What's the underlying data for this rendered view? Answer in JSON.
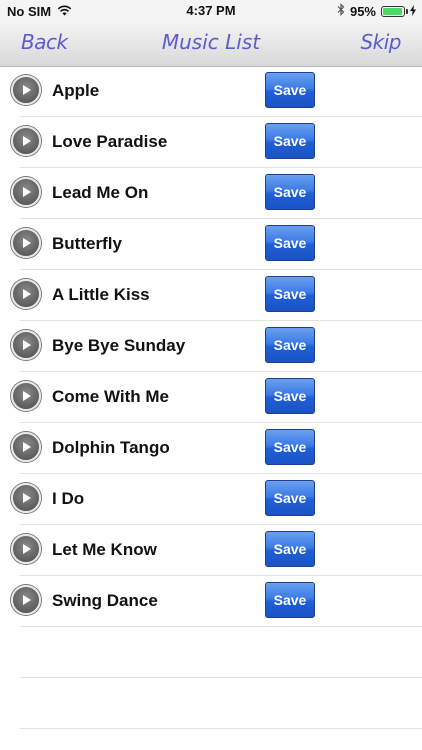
{
  "status_bar": {
    "carrier": "No SIM",
    "time": "4:37 PM",
    "battery_percent": "95%",
    "battery_level": 0.95,
    "icons": [
      "wifi-icon",
      "bluetooth-icon",
      "battery-icon",
      "charging-icon"
    ]
  },
  "nav": {
    "back_label": "Back",
    "title": "Music List",
    "skip_label": "Skip",
    "accent_color": "#5b5bd0"
  },
  "songs": [
    {
      "title": "Apple",
      "save_label": "Save"
    },
    {
      "title": "Love Paradise",
      "save_label": "Save"
    },
    {
      "title": "Lead Me On",
      "save_label": "Save"
    },
    {
      "title": "Butterfly",
      "save_label": "Save"
    },
    {
      "title": "A Little Kiss",
      "save_label": "Save"
    },
    {
      "title": "Bye Bye Sunday",
      "save_label": "Save"
    },
    {
      "title": "Come With Me",
      "save_label": "Save"
    },
    {
      "title": "Dolphin Tango",
      "save_label": "Save"
    },
    {
      "title": "I Do",
      "save_label": "Save"
    },
    {
      "title": "Let Me Know",
      "save_label": "Save"
    },
    {
      "title": "Swing Dance",
      "save_label": "Save"
    }
  ],
  "colors": {
    "save_button": "#1f5fd6",
    "battery_fill": "#4cd964"
  }
}
